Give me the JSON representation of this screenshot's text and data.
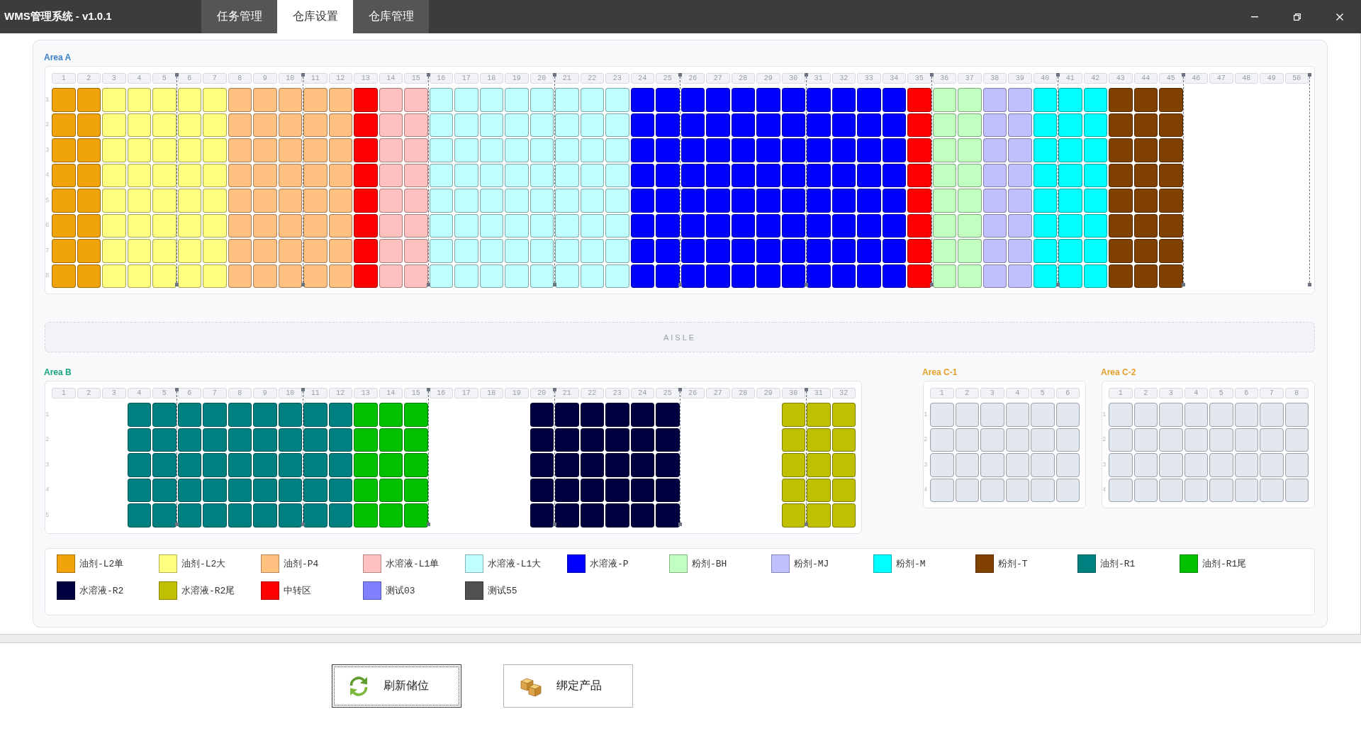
{
  "window": {
    "title": "WMS管理系统 - v1.0.1"
  },
  "tabs": [
    {
      "label": "任务管理",
      "selected": false
    },
    {
      "label": "仓库设置",
      "selected": true
    },
    {
      "label": "仓库管理",
      "selected": false
    }
  ],
  "upper_areas": [
    {
      "label": "Area A",
      "color": "#3a80c8",
      "dividers": true,
      "rows": [
        "1",
        "2",
        "3",
        "4",
        "5",
        "6",
        "7",
        "8"
      ],
      "columns": [
        {
          "label": "1",
          "kind": "occupied",
          "color": "#f0a30a"
        },
        {
          "label": "2",
          "kind": "occupied",
          "color": "#f0a30a"
        },
        {
          "label": "3",
          "kind": "occupied",
          "color": "#ffff80"
        },
        {
          "label": "4",
          "kind": "occupied",
          "color": "#ffff80"
        },
        {
          "label": "5",
          "kind": "occupied",
          "color": "#ffff80"
        },
        {
          "label": "6",
          "kind": "occupied",
          "color": "#ffff80"
        },
        {
          "label": "7",
          "kind": "occupied",
          "color": "#ffff80"
        },
        {
          "label": "8",
          "kind": "occupied",
          "color": "#ffc080"
        },
        {
          "label": "9",
          "kind": "occupied",
          "color": "#ffc080"
        },
        {
          "label": "10",
          "kind": "occupied",
          "color": "#ffc080"
        },
        {
          "label": "11",
          "kind": "occupied",
          "color": "#ffc080"
        },
        {
          "label": "12",
          "kind": "occupied",
          "color": "#ffc080"
        },
        {
          "label": "13",
          "kind": "occupied",
          "color": "#ff0000"
        },
        {
          "label": "14",
          "kind": "occupied",
          "color": "#ffc0c0"
        },
        {
          "label": "15",
          "kind": "occupied",
          "color": "#ffc0c0"
        },
        {
          "label": "16",
          "kind": "occupied",
          "color": "#c0ffff"
        },
        {
          "label": "17",
          "kind": "occupied",
          "color": "#c0ffff"
        },
        {
          "label": "18",
          "kind": "occupied",
          "color": "#c0ffff"
        },
        {
          "label": "19",
          "kind": "occupied",
          "color": "#c0ffff"
        },
        {
          "label": "20",
          "kind": "occupied",
          "color": "#c0ffff"
        },
        {
          "label": "21",
          "kind": "occupied",
          "color": "#c0ffff"
        },
        {
          "label": "22",
          "kind": "occupied",
          "color": "#c0ffff"
        },
        {
          "label": "23",
          "kind": "occupied",
          "color": "#c0ffff"
        },
        {
          "label": "24",
          "kind": "occupied",
          "color": "#0000ff"
        },
        {
          "label": "25",
          "kind": "occupied",
          "color": "#0000ff"
        },
        {
          "label": "26",
          "kind": "occupied",
          "color": "#0000ff"
        },
        {
          "label": "27",
          "kind": "occupied",
          "color": "#0000ff"
        },
        {
          "label": "28",
          "kind": "occupied",
          "color": "#0000ff"
        },
        {
          "label": "29",
          "kind": "occupied",
          "color": "#0000ff"
        },
        {
          "label": "30",
          "kind": "occupied",
          "color": "#0000ff"
        },
        {
          "label": "31",
          "kind": "occupied",
          "color": "#0000ff"
        },
        {
          "label": "32",
          "kind": "occupied",
          "color": "#0000ff"
        },
        {
          "label": "33",
          "kind": "occupied",
          "color": "#0000ff"
        },
        {
          "label": "34",
          "kind": "occupied",
          "color": "#0000ff"
        },
        {
          "label": "35",
          "kind": "occupied",
          "color": "#ff0000"
        },
        {
          "label": "36",
          "kind": "occupied",
          "color": "#c0ffc0"
        },
        {
          "label": "37",
          "kind": "occupied",
          "color": "#c0ffc0"
        },
        {
          "label": "38",
          "kind": "occupied",
          "color": "#c0c0ff"
        },
        {
          "label": "39",
          "kind": "occupied",
          "color": "#c0c0ff"
        },
        {
          "label": "40",
          "kind": "occupied",
          "color": "#00ffff"
        },
        {
          "label": "41",
          "kind": "occupied",
          "color": "#00ffff"
        },
        {
          "label": "42",
          "kind": "occupied",
          "color": "#00ffff"
        },
        {
          "label": "43",
          "kind": "occupied",
          "color": "#804000"
        },
        {
          "label": "44",
          "kind": "occupied",
          "color": "#804000"
        },
        {
          "label": "45",
          "kind": "occupied",
          "color": "#804000"
        },
        {
          "label": "46",
          "kind": "unused"
        },
        {
          "label": "47",
          "kind": "unused"
        },
        {
          "label": "48",
          "kind": "unused"
        },
        {
          "label": "49",
          "kind": "unused"
        },
        {
          "label": "50",
          "kind": "unused"
        }
      ]
    }
  ],
  "aisle": {
    "label": "AISLE"
  },
  "lower_areas": [
    {
      "label": "Area B",
      "color": "#17a77a",
      "dividers": true,
      "rows": [
        "1",
        "2",
        "3",
        "4",
        "5"
      ],
      "columns": [
        {
          "label": "1",
          "kind": "unused"
        },
        {
          "label": "2",
          "kind": "unused"
        },
        {
          "label": "3",
          "kind": "unused"
        },
        {
          "label": "4",
          "kind": "occupied",
          "color": "#008080"
        },
        {
          "label": "5",
          "kind": "occupied",
          "color": "#008080"
        },
        {
          "label": "6",
          "kind": "occupied",
          "color": "#008080"
        },
        {
          "label": "7",
          "kind": "occupied",
          "color": "#008080"
        },
        {
          "label": "8",
          "kind": "occupied",
          "color": "#008080"
        },
        {
          "label": "9",
          "kind": "occupied",
          "color": "#008080"
        },
        {
          "label": "10",
          "kind": "occupied",
          "color": "#008080"
        },
        {
          "label": "11",
          "kind": "occupied",
          "color": "#008080"
        },
        {
          "label": "12",
          "kind": "occupied",
          "color": "#008080"
        },
        {
          "label": "13",
          "kind": "occupied",
          "color": "#00c000"
        },
        {
          "label": "14",
          "kind": "occupied",
          "color": "#00c000"
        },
        {
          "label": "15",
          "kind": "occupied",
          "color": "#00c000"
        },
        {
          "label": "16",
          "kind": "unused"
        },
        {
          "label": "17",
          "kind": "unused"
        },
        {
          "label": "18",
          "kind": "unused"
        },
        {
          "label": "19",
          "kind": "unused"
        },
        {
          "label": "20",
          "kind": "occupied",
          "color": "#000040"
        },
        {
          "label": "21",
          "kind": "occupied",
          "color": "#000040"
        },
        {
          "label": "22",
          "kind": "occupied",
          "color": "#000040"
        },
        {
          "label": "23",
          "kind": "occupied",
          "color": "#000040"
        },
        {
          "label": "24",
          "kind": "occupied",
          "color": "#000040"
        },
        {
          "label": "25",
          "kind": "occupied",
          "color": "#000040"
        },
        {
          "label": "26",
          "kind": "unused"
        },
        {
          "label": "27",
          "kind": "unused"
        },
        {
          "label": "28",
          "kind": "unused"
        },
        {
          "label": "29",
          "kind": "unused"
        },
        {
          "label": "30",
          "kind": "occupied",
          "color": "#c0c000"
        },
        {
          "label": "31",
          "kind": "occupied",
          "color": "#c0c000"
        },
        {
          "label": "32",
          "kind": "occupied",
          "color": "#c0c000"
        }
      ]
    },
    {
      "label": "Area C-1",
      "color": "#e3a127",
      "dividers": false,
      "rows": [
        "1",
        "2",
        "3",
        "4"
      ],
      "columns": [
        {
          "label": "1",
          "kind": "vacant"
        },
        {
          "label": "2",
          "kind": "vacant"
        },
        {
          "label": "3",
          "kind": "vacant"
        },
        {
          "label": "4",
          "kind": "vacant"
        },
        {
          "label": "5",
          "kind": "vacant"
        },
        {
          "label": "6",
          "kind": "vacant"
        }
      ]
    },
    {
      "label": "Area C-2",
      "color": "#e3a127",
      "dividers": false,
      "rows": [
        "1",
        "2",
        "3",
        "4"
      ],
      "columns": [
        {
          "label": "1",
          "kind": "vacant"
        },
        {
          "label": "2",
          "kind": "vacant"
        },
        {
          "label": "3",
          "kind": "vacant"
        },
        {
          "label": "4",
          "kind": "vacant"
        },
        {
          "label": "5",
          "kind": "vacant"
        },
        {
          "label": "6",
          "kind": "vacant"
        },
        {
          "label": "7",
          "kind": "vacant"
        },
        {
          "label": "8",
          "kind": "vacant"
        }
      ]
    }
  ],
  "legend": [
    {
      "label": "油剂-L2单",
      "color": "#f0a30a"
    },
    {
      "label": "油剂-L2大",
      "color": "#ffff80"
    },
    {
      "label": "油剂-P4",
      "color": "#ffc080"
    },
    {
      "label": "水溶液-L1单",
      "color": "#ffc0c0"
    },
    {
      "label": "水溶液-L1大",
      "color": "#c0ffff"
    },
    {
      "label": "水溶液-P",
      "color": "#0000ff"
    },
    {
      "label": "粉剂-BH",
      "color": "#c0ffc0"
    },
    {
      "label": "粉剂-MJ",
      "color": "#c0c0ff"
    },
    {
      "label": "粉剂-M",
      "color": "#00ffff"
    },
    {
      "label": "粉剂-T",
      "color": "#804000"
    },
    {
      "label": "油剂-R1",
      "color": "#008080"
    },
    {
      "label": "油剂-R1尾",
      "color": "#00c000"
    },
    {
      "label": "水溶液-R2",
      "color": "#000040"
    },
    {
      "label": "水溶液-R2尾",
      "color": "#c0c000"
    },
    {
      "label": "中转区",
      "color": "#ff0000"
    },
    {
      "label": "测试03",
      "color": "#8080ff"
    },
    {
      "label": "测试55",
      "color": "#505050"
    }
  ],
  "buttons": [
    {
      "label": "刷新储位",
      "kind": "refresh",
      "focused": true
    },
    {
      "label": "绑定产品",
      "kind": "bind",
      "focused": false
    }
  ]
}
